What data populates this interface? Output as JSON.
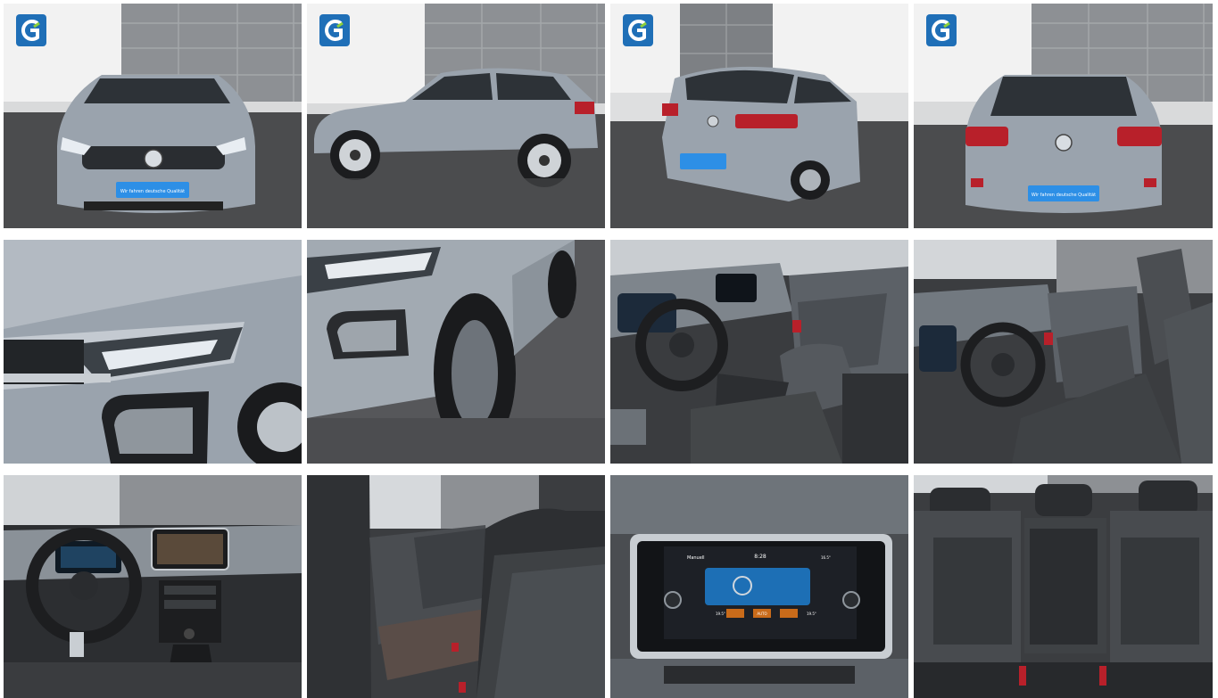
{
  "gallery": {
    "tiles": [
      {
        "id": "front",
        "logo": true,
        "plate": "Wir fahren deutsche Qualität"
      },
      {
        "id": "side",
        "logo": true
      },
      {
        "id": "rear-three-quarter",
        "logo": true
      },
      {
        "id": "rear",
        "logo": true,
        "plate": "Wir fahren deutsche Qualität"
      },
      {
        "id": "headlight-closeup"
      },
      {
        "id": "front-wheel-closeup"
      },
      {
        "id": "interior-driver"
      },
      {
        "id": "interior-cabin"
      },
      {
        "id": "dashboard"
      },
      {
        "id": "rear-seats-side"
      },
      {
        "id": "infotainment-screen",
        "screen": {
          "top_left": "Manuell",
          "time": "8:28",
          "temp_left": "19.5°",
          "temp_mid": "AUTO",
          "temp_right": "19.5°",
          "right_value": "16.5°"
        }
      },
      {
        "id": "rear-bench"
      }
    ]
  },
  "colors": {
    "car_silver": "#9aa3ad",
    "wall_grey": "#8a8d90",
    "floor_dark": "#4a4b4d",
    "brand_blue": "#1f6fb7",
    "plate_blue": "#2d8fe6",
    "taillight_red": "#b8202a"
  },
  "icons": [
    "company-logo-icon",
    "vw-emblem-icon"
  ]
}
